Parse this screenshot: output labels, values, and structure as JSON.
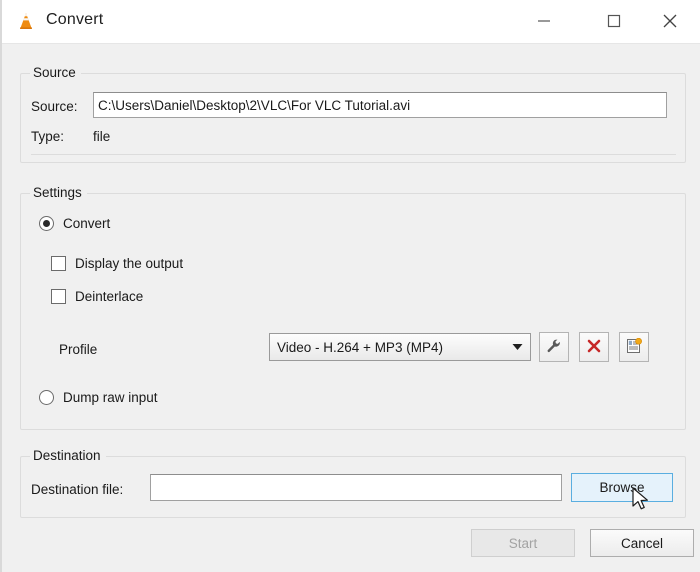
{
  "window": {
    "title": "Convert",
    "icon": "vlc-cone-icon",
    "controls": {
      "minimize": "minimize-icon",
      "maximize": "maximize-icon",
      "close": "close-icon"
    }
  },
  "source": {
    "group_title": "Source",
    "source_label": "Source:",
    "source_value": "C:\\Users\\Daniel\\Desktop\\2\\VLC\\For VLC Tutorial.avi",
    "source_placeholder": "",
    "type_label": "Type:",
    "type_value": "file"
  },
  "settings": {
    "group_title": "Settings",
    "convert_label": "Convert",
    "convert_selected": true,
    "display_output_label": "Display the output",
    "display_output_checked": false,
    "deinterlace_label": "Deinterlace",
    "deinterlace_checked": false,
    "profile_label": "Profile",
    "profile_selected": "Video - H.264 + MP3 (MP4)",
    "profile_options": [
      "Video - H.264 + MP3 (MP4)"
    ],
    "profile_edit_icon": "wrench-icon",
    "profile_delete_icon": "red-x-icon",
    "profile_new_icon": "new-profile-icon",
    "dump_raw_label": "Dump raw input",
    "dump_raw_selected": false
  },
  "destination": {
    "group_title": "Destination",
    "dest_file_label": "Destination file:",
    "dest_file_value": "",
    "dest_file_placeholder": "",
    "browse_label": "Browse"
  },
  "footer": {
    "start_label": "Start",
    "start_enabled": false,
    "cancel_label": "Cancel"
  },
  "colors": {
    "dialog_background": "#f0f0f0",
    "titlebar_background": "#ffffff",
    "group_border": "#dcdcdc",
    "accent_hover": "#5aaee0",
    "accent_hover_fill": "#e5f2fb",
    "delete_icon": "#cc2222",
    "vlc_cone": "#e8810c",
    "disabled_text": "#a3a3a3"
  }
}
